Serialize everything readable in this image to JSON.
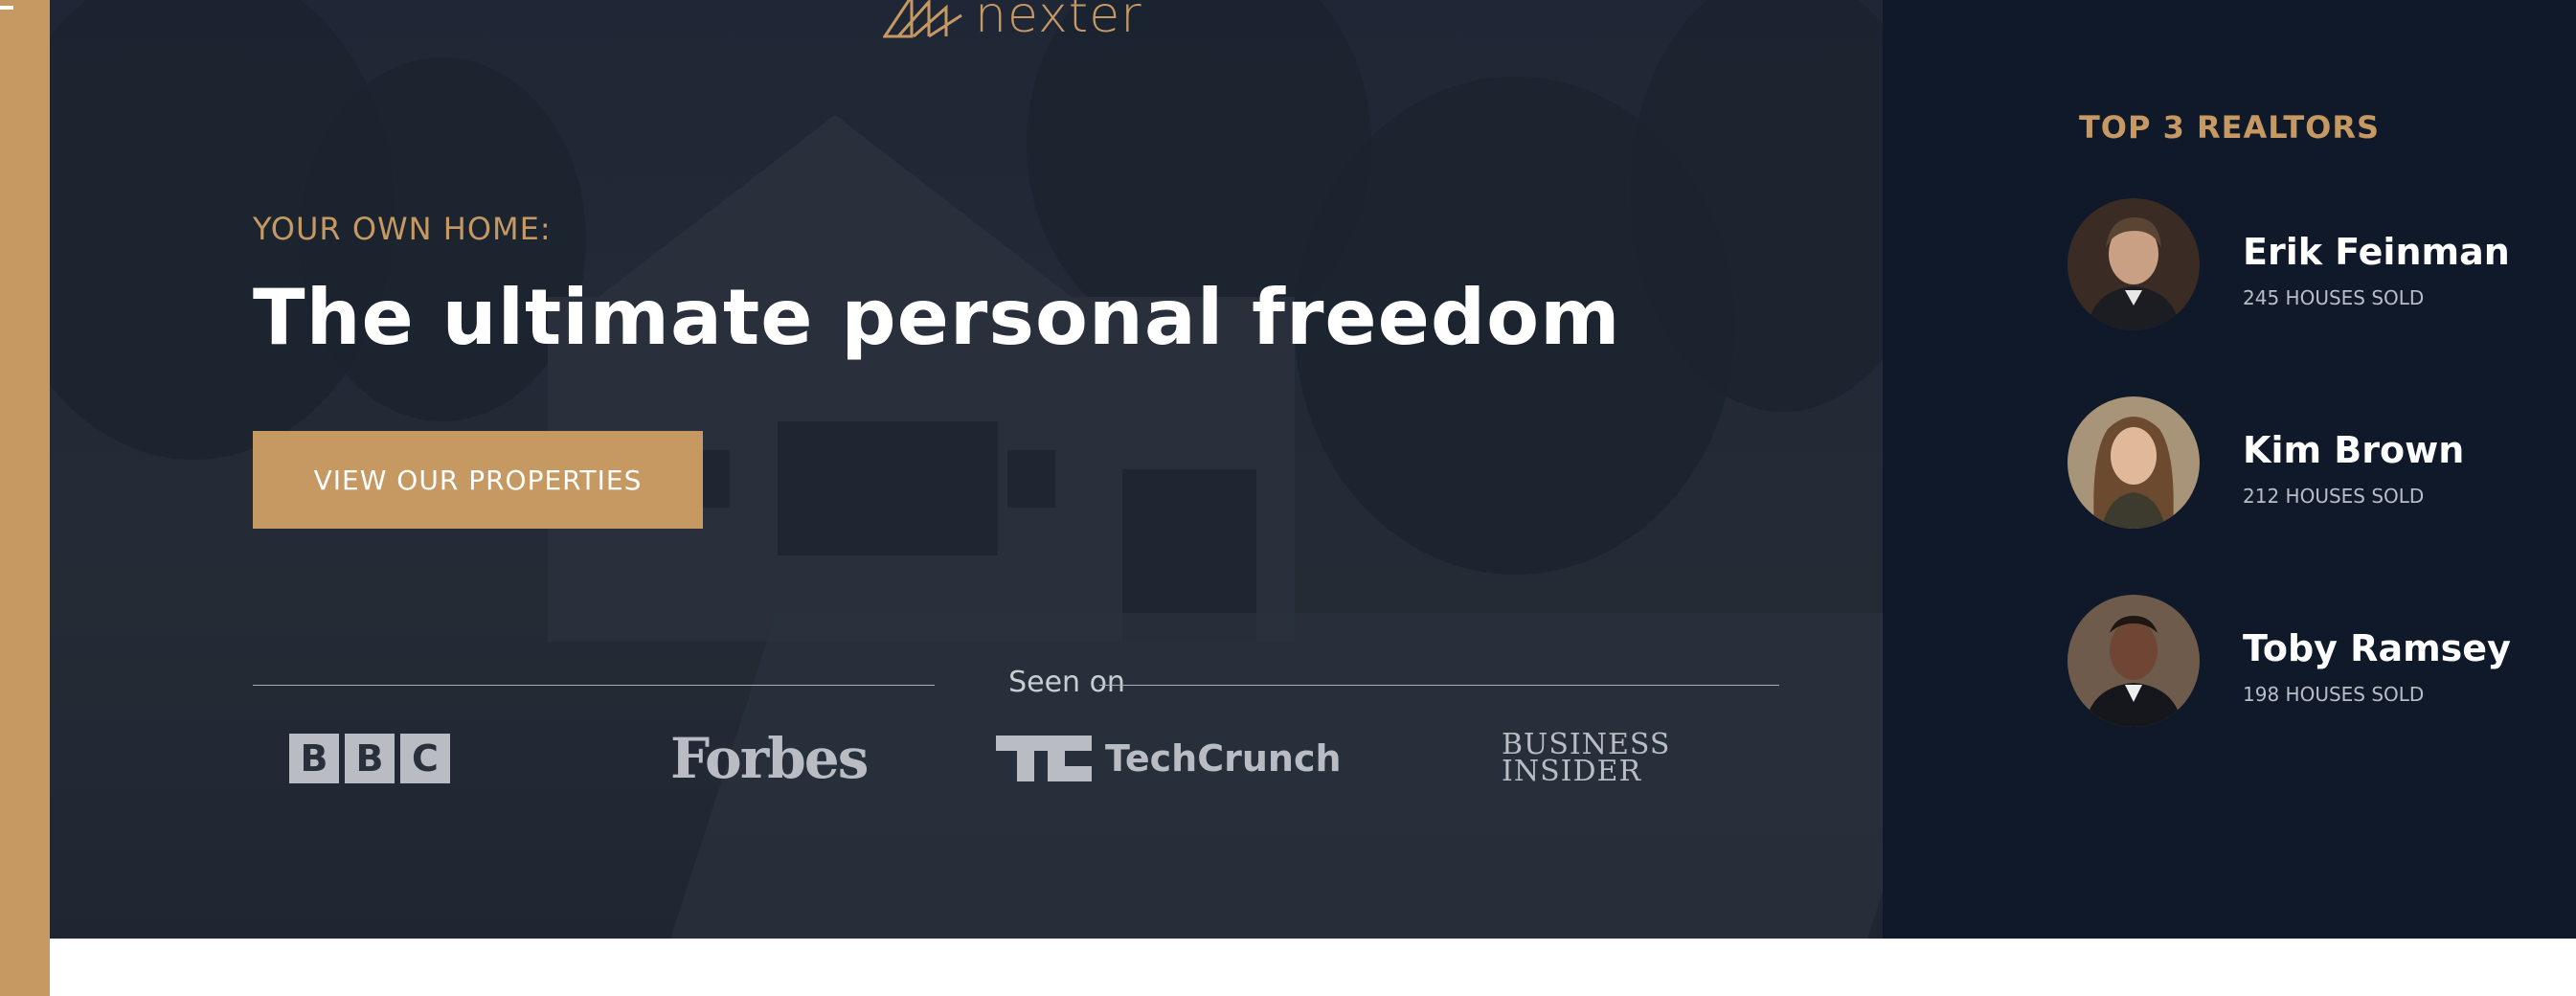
{
  "brand": {
    "name": "nexter"
  },
  "hero": {
    "eyebrow": "YOUR OWN HOME:",
    "headline": "The ultimate personal freedom",
    "cta_label": "VIEW OUR PROPERTIES",
    "seen_on_label": "Seen on",
    "press": [
      {
        "name": "BBC",
        "letters": [
          "B",
          "B",
          "C"
        ]
      },
      {
        "name": "Forbes"
      },
      {
        "name": "TechCrunch"
      },
      {
        "name": "Business Insider",
        "line1": "BUSINESS",
        "line2": "INSIDER"
      }
    ]
  },
  "realtors": {
    "title": "TOP 3 REALTORS",
    "items": [
      {
        "name": "Erik Feinman",
        "sold": "245 HOUSES SOLD"
      },
      {
        "name": "Kim Brown",
        "sold": "212 HOUSES SOLD"
      },
      {
        "name": "Toby Ramsey",
        "sold": "198 HOUSES SOLD"
      }
    ]
  },
  "colors": {
    "accent": "#c69963",
    "dark": "#101929",
    "white": "#ffffff"
  }
}
